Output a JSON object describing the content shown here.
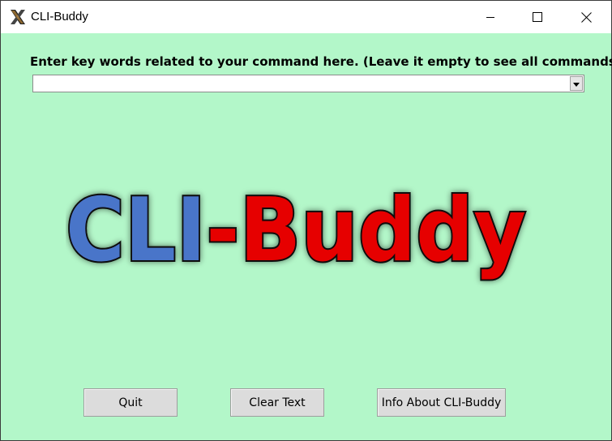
{
  "window": {
    "title": "CLI-Buddy",
    "icon": "x-app-icon",
    "background_color": "#b3f7c9",
    "controls": {
      "minimize_icon": "minimize-icon",
      "maximize_icon": "maximize-icon",
      "close_icon": "close-icon"
    }
  },
  "search": {
    "prompt": "Enter key words related to your command here. (Leave it empty to see all commands)",
    "value": "",
    "dropdown_icon": "dropdown-arrow-icon"
  },
  "logo": {
    "part1": "CLI",
    "part2": "-Buddy",
    "part1_color": "#4a74c9",
    "part2_color": "#e60000"
  },
  "buttons": {
    "quit": "Quit",
    "clear": "Clear Text",
    "info": "Info About CLI-Buddy"
  }
}
